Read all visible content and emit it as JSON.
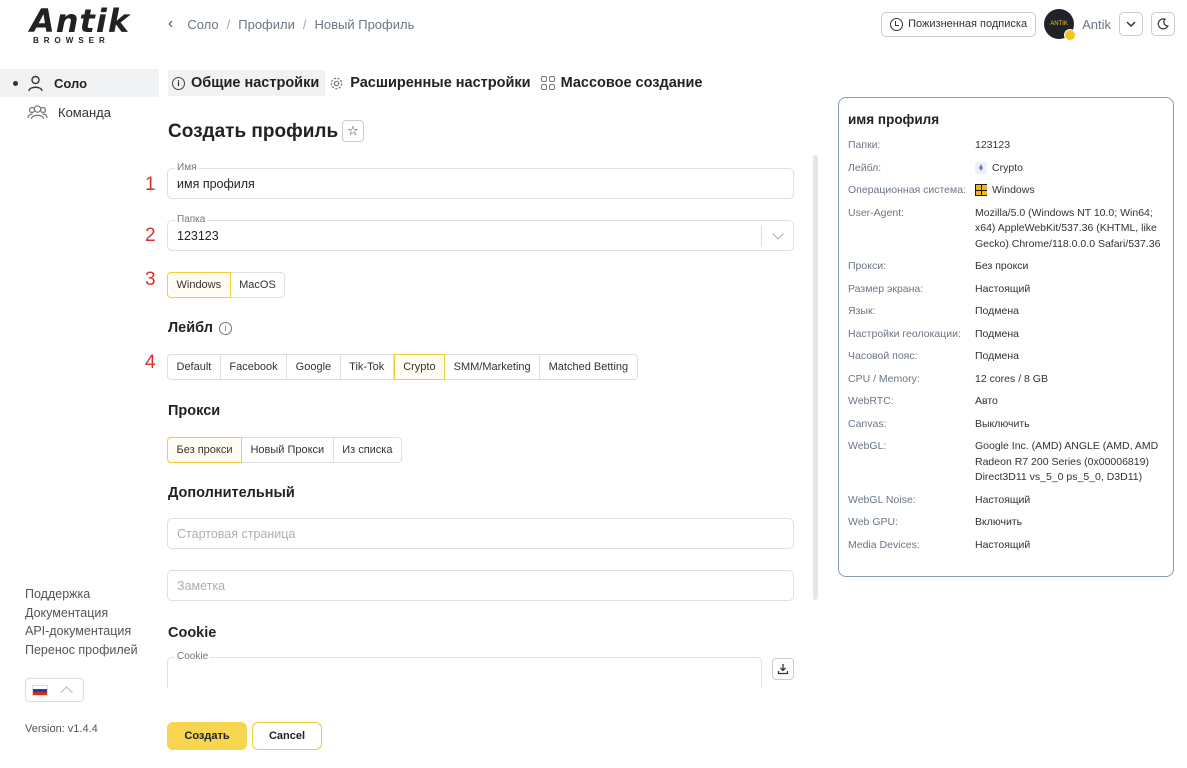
{
  "brand": {
    "name": "Antik",
    "tagline": "BROWSER"
  },
  "breadcrumb": {
    "items": [
      "Соло",
      "Профили",
      "Новый Профиль"
    ]
  },
  "header": {
    "subscription_label": "Пожизненная подписка",
    "user_name": "Antik",
    "avatar_text": "ANTIK"
  },
  "sidebar": {
    "items": [
      {
        "label": "Соло",
        "icon": "user-icon",
        "active": true
      },
      {
        "label": "Команда",
        "icon": "team-icon",
        "active": false
      }
    ],
    "links": [
      "Поддержка",
      "Документация",
      "API-документация",
      "Перенос профилей"
    ],
    "version": "Version: v1.4.4",
    "language_flag": "ru-flag-icon"
  },
  "tabs": [
    {
      "label": "Общие настройки",
      "icon": "info-icon",
      "active": true
    },
    {
      "label": "Расширенные настройки",
      "icon": "gear-icon",
      "active": false
    },
    {
      "label": "Массовое создание",
      "icon": "grid-icon",
      "active": false
    }
  ],
  "form": {
    "title": "Создать профиль",
    "markers": [
      "1",
      "2",
      "3",
      "4"
    ],
    "name": {
      "label": "Имя",
      "value": "имя профиля"
    },
    "folder": {
      "label": "Папка",
      "value": "123123"
    },
    "os_options": [
      "Windows",
      "MacOS"
    ],
    "os_selected": "Windows",
    "label_section": "Лейбл",
    "label_options": [
      "Default",
      "Facebook",
      "Google",
      "Tik-Tok",
      "Crypto",
      "SMM/Marketing",
      "Matched Betting"
    ],
    "label_selected": "Crypto",
    "proxy_section": "Прокси",
    "proxy_options": [
      "Без прокси",
      "Новый Прокси",
      "Из списка"
    ],
    "proxy_selected": "Без прокси",
    "extra_section": "Дополнительный",
    "start_page_placeholder": "Стартовая страница",
    "note_placeholder": "Заметка",
    "cookie_section": "Cookie",
    "cookie_label": "Cookie",
    "create_button": "Создать",
    "cancel_button": "Cancel"
  },
  "summary": {
    "title": "имя профиля",
    "rows": [
      {
        "key": "Папки:",
        "value": "123123"
      },
      {
        "key": "Лейбл:",
        "value": "Crypto",
        "icon": "ethereum-icon"
      },
      {
        "key": "Операционная система:",
        "value": "Windows",
        "icon": "windows-icon"
      },
      {
        "key": "User-Agent:",
        "value": "Mozilla/5.0 (Windows NT 10.0; Win64; x64) AppleWebKit/537.36 (KHTML, like Gecko) Chrome/118.0.0.0 Safari/537.36"
      },
      {
        "key": "Прокси:",
        "value": "Без прокси"
      },
      {
        "key": "Размер экрана:",
        "value": "Настоящий"
      },
      {
        "key": "Язык:",
        "value": "Подмена"
      },
      {
        "key": "Настройки геолокации:",
        "value": "Подмена"
      },
      {
        "key": "Часовой пояс:",
        "value": "Подмена"
      },
      {
        "key": "CPU / Memory:",
        "value": "12 cores / 8 GB"
      },
      {
        "key": "WebRTC:",
        "value": "Авто"
      },
      {
        "key": "Canvas:",
        "value": "Выключить"
      },
      {
        "key": "WebGL:",
        "value": "Google Inc. (AMD) ANGLE (AMD, AMD Radeon R7 200 Series (0x00006819) Direct3D11 vs_5_0 ps_5_0, D3D11)"
      },
      {
        "key": "WebGL Noise:",
        "value": "Настоящий"
      },
      {
        "key": "Web GPU:",
        "value": "Включить"
      },
      {
        "key": "Media Devices:",
        "value": "Настоящий"
      }
    ]
  },
  "colors": {
    "accent": "#f7d550",
    "accent_border": "#f2cd3a",
    "marker": "#d9302c",
    "card_border": "#8a9bb0"
  }
}
